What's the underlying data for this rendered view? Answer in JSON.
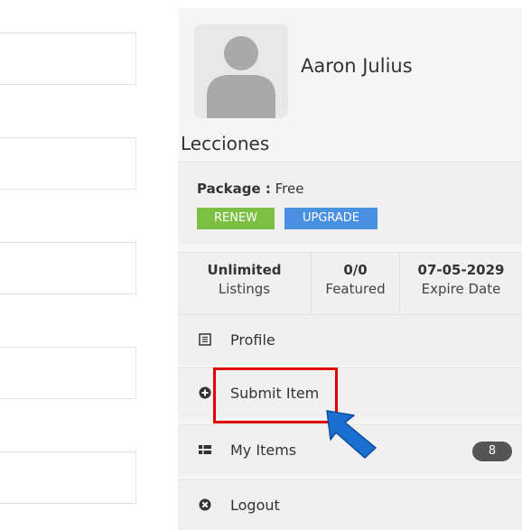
{
  "user": {
    "name": "Aaron Julius"
  },
  "section": {
    "title": "Lecciones"
  },
  "package": {
    "label": "Package :",
    "value": "Free",
    "renew_label": "RENEW",
    "upgrade_label": "UPGRADE"
  },
  "stats": [
    {
      "value": "Unlimited",
      "label": "Listings"
    },
    {
      "value": "0/0",
      "label": "Featured"
    },
    {
      "value": "07-05-2029",
      "label": "Expire Date"
    }
  ],
  "menu": {
    "profile": {
      "label": "Profile",
      "icon": "profile-card-icon"
    },
    "submit": {
      "label": "Submit Item",
      "icon": "plus-circle-icon"
    },
    "my_items": {
      "label": "My Items",
      "icon": "list-icon",
      "count": "8"
    },
    "logout": {
      "label": "Logout",
      "icon": "close-circle-icon"
    }
  },
  "colors": {
    "renew": "#7bc043",
    "upgrade": "#4a90e2",
    "highlight": "#e00000",
    "arrow": "#1a6fd1",
    "badge": "#555555"
  }
}
